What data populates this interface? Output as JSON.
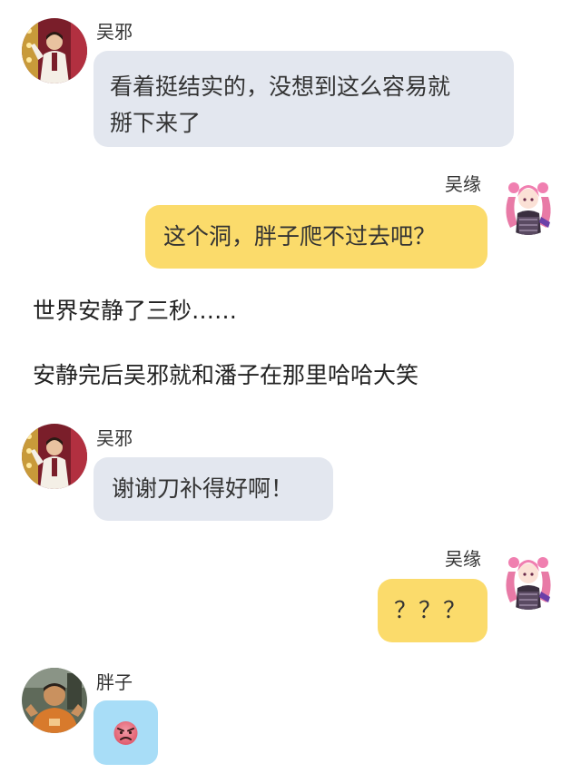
{
  "messages": [
    {
      "sender": "吴邪",
      "avatar_icon": "man-in-white-suit-avatar",
      "text": "看着挺结实的，没想到这么容易就掰下来了",
      "line1": "看着挺结实的，没想到这么容易就",
      "line2": "掰下来了"
    },
    {
      "sender": "吴缘",
      "avatar_icon": "pink-haired-girl-avatar",
      "text": "这个洞，胖子爬不过去吧？"
    },
    {
      "sender": "吴邪",
      "avatar_icon": "man-in-white-suit-avatar",
      "text": "谢谢刀补得好啊！"
    },
    {
      "sender": "吴缘",
      "avatar_icon": "pink-haired-girl-avatar",
      "text": "？？？"
    },
    {
      "sender": "胖子",
      "avatar_icon": "chubby-man-avatar",
      "emoji_icon": "angry-face-emoji"
    }
  ],
  "narrations": [
    "世界安静了三秒……",
    "安静完后吴邪就和潘子在那里哈哈大笑"
  ],
  "colors": {
    "incoming_bubble": "#e3e7ef",
    "outgoing_bubble": "#fbdb6b",
    "emoji_bubble": "#a8ddf7"
  }
}
